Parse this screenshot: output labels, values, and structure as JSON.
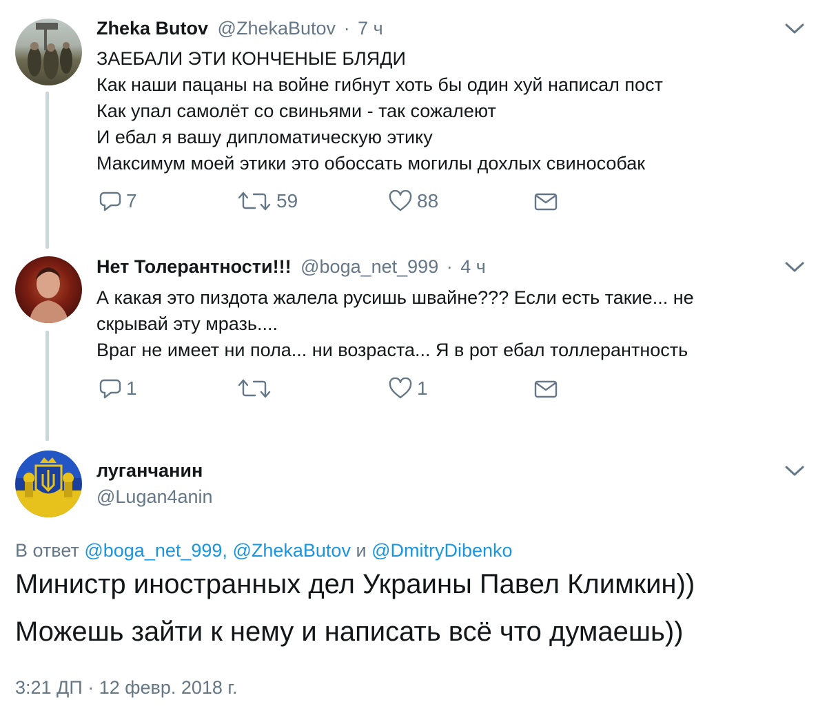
{
  "tweets": [
    {
      "name": "Zheka Butov",
      "handle": "@ZhekaButov",
      "separator": "·",
      "time": "7 ч",
      "lines": [
        "ЗАЕБАЛИ ЭТИ КОНЧЕНЫЕ БЛЯДИ",
        "Как наши пацаны на войне гибнут хоть бы один хуй написал пост",
        "Как упал самолёт со свиньями - так сожалеют",
        "И ебал я вашу дипломатическую этику",
        "Максимум моей этики это обоссать могилы дохлых свинособак"
      ],
      "replies": "7",
      "retweets": "59",
      "likes": "88"
    },
    {
      "name": "Нет Толерантности!!!",
      "handle": "@boga_net_999",
      "separator": "·",
      "time": "4 ч",
      "lines": [
        "А какая это пиздота жалела русишь швайне???  Если есть такие... не",
        "скрывай эту мразь....",
        "Враг не имеет ни пола... ни возраста...  Я в рот ебал толлерантность"
      ],
      "replies": "1",
      "retweets": "",
      "likes": "1"
    }
  ],
  "main_tweet": {
    "name": "луганчанин",
    "handle": "@Lugan4anin",
    "reply_prefix": "В ответ",
    "reply_user_1": "@boga_net_999,",
    "reply_user_2": "@ZhekaButov",
    "reply_and": "и",
    "reply_user_3": "@DmitryDibenko",
    "line1": "Министр иностранных дел Украины Павел Климкин))",
    "line2": "Можешь зайти к нему и написать всё что думаешь))",
    "timestamp": "3:21 ДП · 12 февр. 2018 г."
  },
  "colors": {
    "text": "#14171a",
    "secondary": "#657786",
    "link": "#1b95e0",
    "thread_line": "#ccd6dd"
  },
  "icons": [
    "reply-icon",
    "retweet-icon",
    "like-icon",
    "dm-icon",
    "chevron-down-icon"
  ]
}
